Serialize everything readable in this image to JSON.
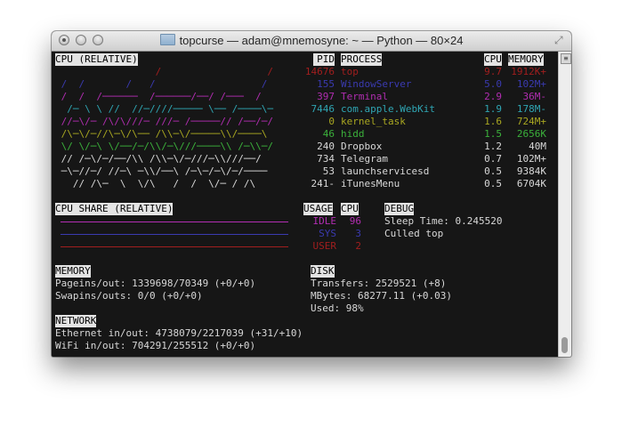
{
  "window": {
    "title": "topcurse — adam@mnemosyne: ~ — Python — 80×24"
  },
  "cpu_panel": {
    "header": "CPU (RELATIVE)",
    "graph_lines": [
      "                 /                  /",
      " /  /       /   /                  /",
      " /  /  /──────  /──────/──/ /───  /",
      "  /─ \\ \\ //  //─////───── \\── /────\\─",
      " //─\\/─ /\\/\\///─ ///─ /─────// /──/─/",
      " /\\─\\/─//\\─\\/\\── /\\\\─\\/─────\\\\/────\\",
      " \\/ \\/─\\ \\/──/─/\\\\/─\\///────\\\\ /─\\\\─/",
      " // /─\\/─/──/\\\\ /\\\\─\\/─///─\\\\///──/",
      " ─\\─//─/ //─\\ ─\\\\/──\\ /─\\─/─\\/─/────",
      "   // /\\─  \\  \\/\\   /  /  \\/─ / /\\"
    ],
    "graph_colors": [
      "#a11e1e",
      "#3a3ab0",
      "#b12db1",
      "#2fa5b3",
      "#b12db1",
      "#a9a721",
      "#3bb13b",
      "#d8d8d8",
      "#d8d8d8",
      "#d8d8d8"
    ]
  },
  "process_table": {
    "headers": {
      "pid": "PID",
      "process": "PROCESS",
      "cpu": "CPU",
      "memory": "MEMORY"
    },
    "rows": [
      {
        "pid": "14676",
        "name": "top",
        "cpu": "9.7",
        "mem": "1912K+",
        "color": "#a11e1e"
      },
      {
        "pid": "155",
        "name": "WindowServer",
        "cpu": "5.0",
        "mem": "102M+",
        "color": "#3a3ab0"
      },
      {
        "pid": "397",
        "name": "Terminal",
        "cpu": "2.9",
        "mem": "36M-",
        "color": "#b12db1"
      },
      {
        "pid": "7446",
        "name": "com.apple.WebKit",
        "cpu": "1.9",
        "mem": "178M-",
        "color": "#2fa5b3"
      },
      {
        "pid": "0",
        "name": "kernel_task",
        "cpu": "1.6",
        "mem": "724M+",
        "color": "#a9a721"
      },
      {
        "pid": "46",
        "name": "hidd",
        "cpu": "1.5",
        "mem": "2656K",
        "color": "#3bb13b"
      },
      {
        "pid": "240",
        "name": "Dropbox",
        "cpu": "1.2",
        "mem": "40M",
        "color": "#d8d8d8"
      },
      {
        "pid": "734",
        "name": "Telegram",
        "cpu": "0.7",
        "mem": "102M+",
        "color": "#d8d8d8"
      },
      {
        "pid": "53",
        "name": "launchservicesd",
        "cpu": "0.5",
        "mem": "9384K",
        "color": "#d8d8d8"
      },
      {
        "pid": "241-",
        "name": "iTunesMenu",
        "cpu": "0.5",
        "mem": "6704K",
        "color": "#d8d8d8"
      }
    ]
  },
  "cpu_share": {
    "header": "CPU SHARE (RELATIVE)",
    "usage_header": "USAGE",
    "cpu_header": "CPU",
    "rows": [
      {
        "label": "IDLE",
        "value": "96",
        "color": "#b12db1",
        "share": 1.0
      },
      {
        "label": "SYS",
        "value": "3",
        "color": "#3a3ab0",
        "share": 1.0
      },
      {
        "label": "USER",
        "value": "2",
        "color": "#a11e1e",
        "share": 1.0
      }
    ]
  },
  "debug": {
    "header": "DEBUG",
    "lines": [
      "Sleep Time: 0.245520",
      "Culled top"
    ]
  },
  "memory": {
    "header": "MEMORY",
    "lines": [
      "Pageins/out: 1339698/70349 (+0/+0)",
      "Swapins/outs: 0/0 (+0/+0)"
    ]
  },
  "disk": {
    "header": "DISK",
    "lines": [
      "Transfers: 2529521 (+8)",
      "MBytes: 68277.11 (+0.03)",
      "Used: 98%"
    ]
  },
  "network": {
    "header": "NETWORK",
    "lines": [
      "Ethernet in/out: 4738079/2217039 (+31/+10)",
      "WiFi in/out: 704291/255512 (+0/+0)"
    ]
  }
}
